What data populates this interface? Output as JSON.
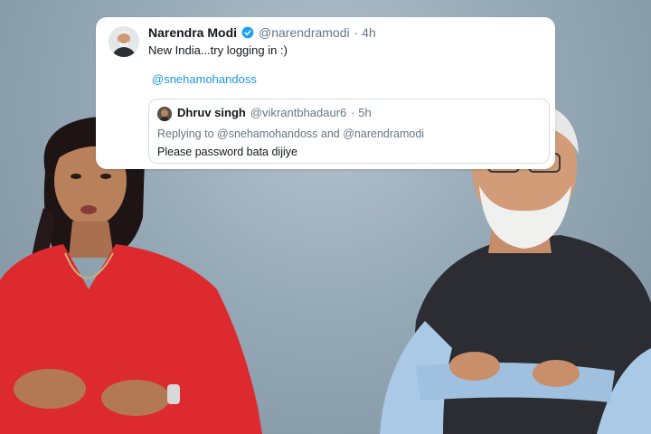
{
  "tweet": {
    "author_name": "Narendra Modi",
    "verified_icon": "verified-badge-icon",
    "handle": "@narendramodi",
    "time": "· 4h",
    "text": "New India...try logging in :)",
    "mention": "@snehamohandoss"
  },
  "quoted_tweet": {
    "author_name": "Dhruv singh",
    "handle": "@vikrantbhadaur6",
    "time": "· 5h",
    "reply_prefix": "Replying to",
    "reply_user1": "@snehamohandoss",
    "reply_and": "and",
    "reply_user2": "@narendramodi",
    "text": "Please password bata dijiye"
  },
  "colors": {
    "link_blue": "#1b95e0",
    "verified_blue": "#1da1f2",
    "background": "#96a9b6"
  }
}
